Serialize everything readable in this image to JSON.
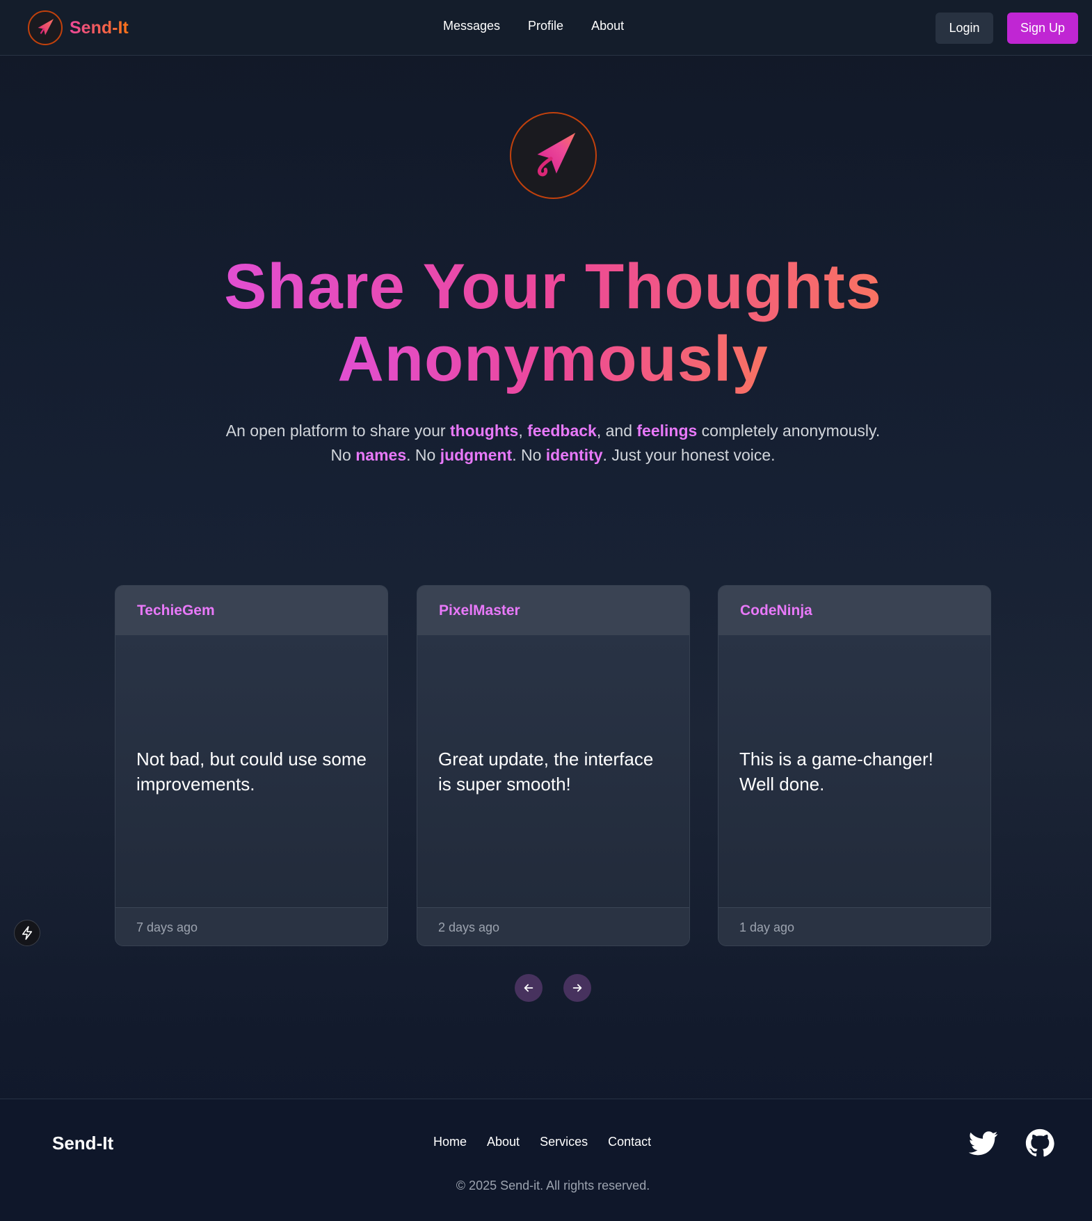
{
  "nav": {
    "brand": "Send-It",
    "links": [
      "Messages",
      "Profile",
      "About"
    ],
    "login_label": "Login",
    "signup_label": "Sign Up"
  },
  "hero": {
    "title_line1": "Share Your Thoughts",
    "title_line2": "Anonymously",
    "sub1": {
      "a": "An open platform to share your ",
      "h1": "thoughts",
      "b": ", ",
      "h2": "feedback",
      "c": ", and ",
      "h3": "feelings",
      "d": " completely anonymously."
    },
    "sub2": {
      "a": "No ",
      "h1": "names",
      "b": ". No ",
      "h2": "judgment",
      "c": ". No ",
      "h3": "identity",
      "d": ". Just your honest voice."
    }
  },
  "cards": [
    {
      "user": "TechieGem",
      "message": "Not bad, but could use some improvements.",
      "time": "7 days ago"
    },
    {
      "user": "PixelMaster",
      "message": "Great update, the interface is super smooth!",
      "time": "2 days ago"
    },
    {
      "user": "CodeNinja",
      "message": "This is a game-changer! Well done.",
      "time": "1 day ago"
    }
  ],
  "footer": {
    "brand": "Send-It",
    "links": [
      "Home",
      "About",
      "Services",
      "Contact"
    ],
    "copyright": "© 2025 Send-it. All rights reserved."
  },
  "icons": {
    "logo": "paper-plane-icon",
    "prev": "arrow-left-icon",
    "next": "arrow-right-icon",
    "bolt": "lightning-icon",
    "twitter": "twitter-icon",
    "github": "github-icon"
  },
  "colors": {
    "accent": "#c026d3",
    "highlight": "#e879f9",
    "gradient_start": "#ec4899",
    "gradient_end": "#f97316"
  }
}
